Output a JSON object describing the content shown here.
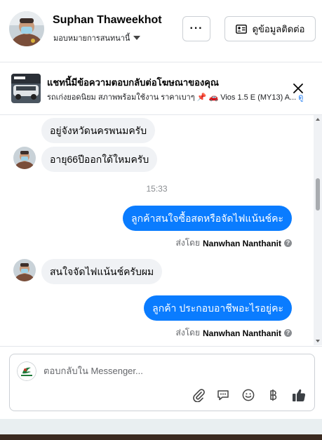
{
  "header": {
    "name": "Suphan Thaweekhot",
    "assignee": "มอบหมายการสนทนานี้",
    "more_label": "···",
    "contact_label": "ดูข้อมูลติดต่อ"
  },
  "ad_notice": {
    "title": "แชทนี้มีข้อความตอบกลับต่อโฆษณาของคุณ",
    "description": "รถเก่งยอดนิยม สภาพพร้อมใช้งาน ราคาเบาๆ 📌 🚗 Vios 1.5 E (MY13) A...",
    "link": "ดู"
  },
  "messages": [
    {
      "type": "in",
      "text": "อยู่จังหวัดนครพนมครับ"
    },
    {
      "type": "in",
      "text": "อายุ66ปีออกใด้ใหมครับ"
    },
    {
      "type": "time",
      "text": "15:33"
    },
    {
      "type": "out",
      "text": "ลูกค้าสนใจซื้อสดหรือจัดไฟแน้นช์คะ"
    },
    {
      "type": "sent_by",
      "prefix": "ส่งโดย",
      "agent": "Nanwhan Nanthanit"
    },
    {
      "type": "in",
      "text": "สนใจจัดไฟแน้นช์ครับผม"
    },
    {
      "type": "out",
      "text": "ลูกค้า ประกอบอาชีพอะไรอยู่คะ"
    },
    {
      "type": "sent_by",
      "prefix": "ส่งโดย",
      "agent": "Nanwhan Nanthanit"
    }
  ],
  "composer": {
    "placeholder": "ตอบกลับใน Messenger...",
    "tools": [
      "paperclip-icon",
      "saved-reply-icon",
      "emoji-icon",
      "baht-payment-icon",
      "thumbs-up-icon"
    ]
  },
  "colors": {
    "accent": "#0a7cff",
    "incoming_bubble": "#f0f2f5",
    "meta_text": "#65676b"
  }
}
